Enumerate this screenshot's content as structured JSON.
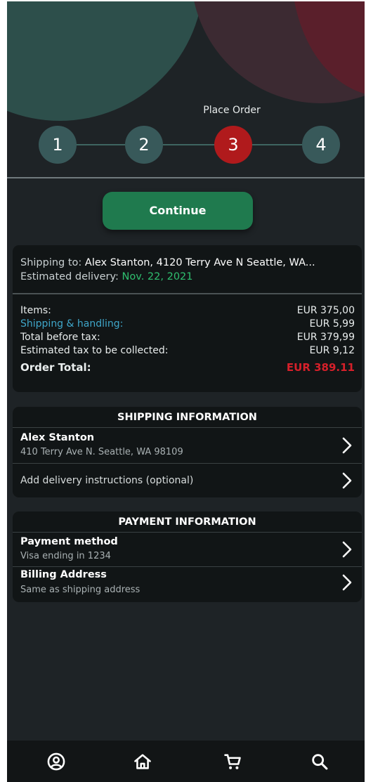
{
  "stepper": {
    "label": "Place Order",
    "steps": [
      {
        "number": "1",
        "active": false
      },
      {
        "number": "2",
        "active": false
      },
      {
        "number": "3",
        "active": true
      },
      {
        "number": "4",
        "active": false
      }
    ]
  },
  "continue_label": "Continue",
  "summary": {
    "shipping_to_label": "Shipping to:",
    "shipping_to_value": "Alex Stanton, 4120 Terry Ave N Seattle, WA...",
    "estimated_delivery_label": "Estimated delivery:",
    "estimated_delivery_value": "Nov. 22, 2021",
    "lines": [
      {
        "label": "Items:",
        "amount": "EUR 375,00"
      },
      {
        "label": "Shipping & handling:",
        "amount": "EUR 5,99"
      },
      {
        "label": "Total before tax:",
        "amount": "EUR 379,99"
      },
      {
        "label": "Estimated tax to be collected:",
        "amount": "EUR 9,12"
      }
    ],
    "order_total_label": "Order Total:",
    "order_total_amount": "EUR 389.11"
  },
  "shipping_info": {
    "title": "SHIPPING INFORMATION",
    "name": "Alex Stanton",
    "address": "410 Terry Ave N. Seattle, WA 98109",
    "delivery_instructions": "Add delivery instructions (optional)"
  },
  "payment_info": {
    "title": "PAYMENT INFORMATION",
    "method_title": "Payment method",
    "method_value": "Visa ending in 1234",
    "billing_title": "Billing Address",
    "billing_value": "Same as shipping address"
  },
  "nav": {
    "items": [
      {
        "icon": "account-icon"
      },
      {
        "icon": "home-icon"
      },
      {
        "icon": "cart-icon"
      },
      {
        "icon": "search-icon"
      }
    ]
  },
  "colors": {
    "background": "#1e2326",
    "card": "#111516",
    "step": "#38595a",
    "step_active": "#b01a1c",
    "continue": "#1f7a4e",
    "delivery_date": "#2fbf6f",
    "shipping_link": "#3fa6c9",
    "order_total": "#d6202a"
  }
}
